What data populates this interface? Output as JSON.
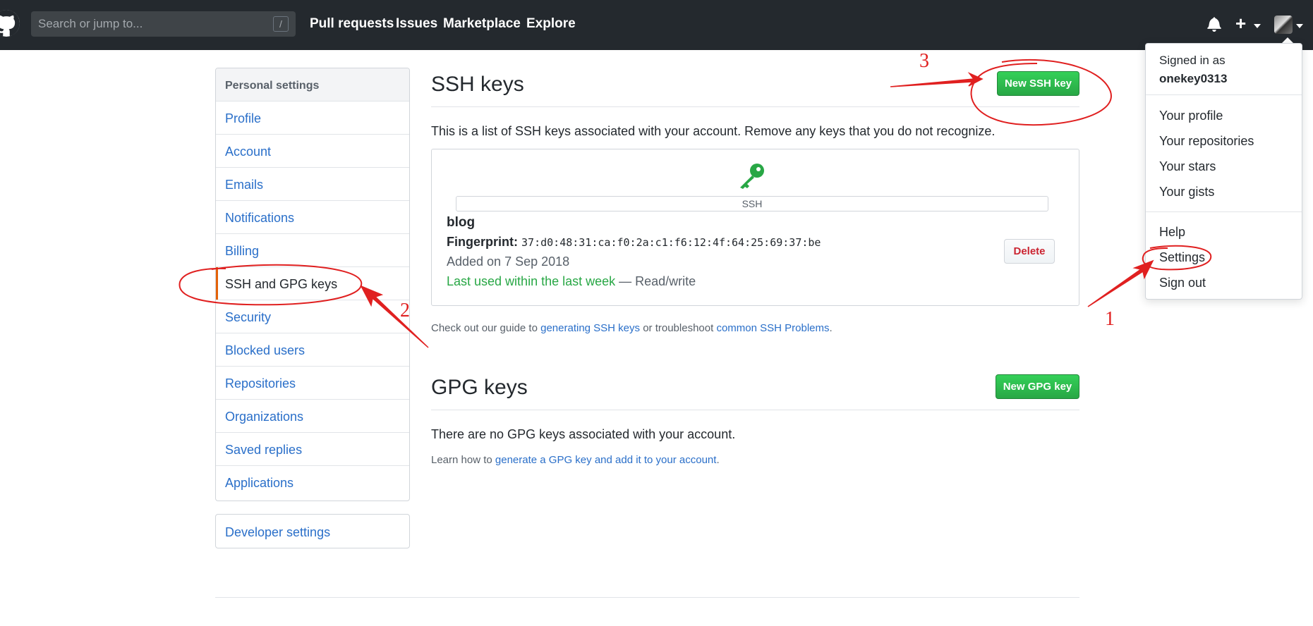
{
  "header": {
    "search_placeholder": "Search or jump to...",
    "slash_key": "/",
    "nav": [
      "Pull requests",
      "Issues",
      "Marketplace",
      "Explore"
    ],
    "plus_icon": "+"
  },
  "sidebar": {
    "heading": "Personal settings",
    "items": [
      {
        "label": "Profile"
      },
      {
        "label": "Account"
      },
      {
        "label": "Emails"
      },
      {
        "label": "Notifications"
      },
      {
        "label": "Billing"
      },
      {
        "label": "SSH and GPG keys",
        "active": true
      },
      {
        "label": "Security"
      },
      {
        "label": "Blocked users"
      },
      {
        "label": "Repositories"
      },
      {
        "label": "Organizations"
      },
      {
        "label": "Saved replies"
      },
      {
        "label": "Applications"
      }
    ],
    "developer_settings": "Developer settings"
  },
  "ssh": {
    "title": "SSH keys",
    "new_button": "New SSH key",
    "description": "This is a list of SSH keys associated with your account. Remove any keys that you do not recognize.",
    "key": {
      "type_label": "SSH",
      "name": "blog",
      "fingerprint_label": "Fingerprint:",
      "fingerprint": "37:d0:48:31:ca:f0:2a:c1:f6:12:4f:64:25:69:37:be",
      "added": "Added on 7 Sep 2018",
      "last_used": "Last used within the last week",
      "access": " — Read/write",
      "delete_button": "Delete"
    },
    "guide_prefix": "Check out our guide to ",
    "guide_link1": "generating SSH keys",
    "guide_middle": " or troubleshoot ",
    "guide_link2": "common SSH Problems",
    "guide_suffix": "."
  },
  "gpg": {
    "title": "GPG keys",
    "new_button": "New GPG key",
    "empty": "There are no GPG keys associated with your account.",
    "learn_prefix": "Learn how to ",
    "learn_link": "generate a GPG key and add it to your account",
    "learn_suffix": "."
  },
  "dropdown": {
    "signed_in_as": "Signed in as",
    "username": "onekey0313",
    "items1": [
      "Your profile",
      "Your repositories",
      "Your stars",
      "Your gists"
    ],
    "items2": [
      "Help",
      "Settings",
      "Sign out"
    ]
  },
  "annotations": {
    "step1": "1",
    "step2": "2",
    "step3": "3",
    "color": "#e02020"
  },
  "colors": {
    "header_bg": "#24292e",
    "link": "#2a6fc9",
    "green": "#28a745",
    "active_bar": "#e36209",
    "danger": "#cb2431"
  }
}
